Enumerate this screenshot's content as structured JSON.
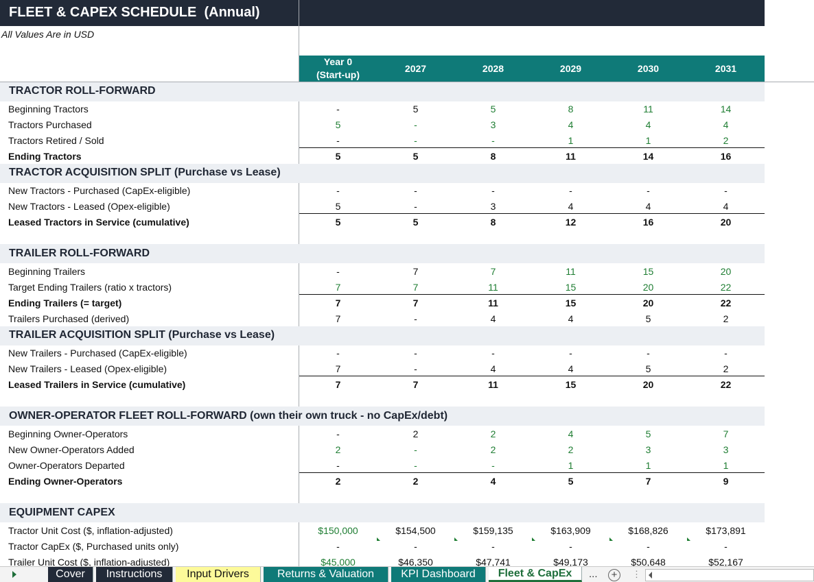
{
  "title": "FLEET & CAPEX SCHEDULE  (Annual)",
  "subtitle": "All Values Are in USD",
  "years": [
    "Year 0\n(Start-up)",
    "2027",
    "2028",
    "2029",
    "2030",
    "2031"
  ],
  "colors": {
    "header_dark": "#222a38",
    "header_teal": "#0f7a78",
    "input_green": "#1e7d32",
    "section_band": "#eceff3"
  },
  "sections": [
    {
      "title": "TRACTOR ROLL-FORWARD"
    },
    {
      "title": "TRACTOR ACQUISITION SPLIT (Purchase vs Lease)"
    },
    {
      "title": "TRAILER ROLL-FORWARD"
    },
    {
      "title": "TRAILER ACQUISITION SPLIT (Purchase vs Lease)"
    },
    {
      "title": "OWNER-OPERATOR FLEET ROLL-FORWARD  (own their own truck - no CapEx/debt)"
    },
    {
      "title": "EQUIPMENT CAPEX"
    }
  ],
  "rows": [
    {
      "label": "Beginning Tractors",
      "values": [
        "-",
        "5",
        "5",
        "8",
        "11",
        "14"
      ]
    },
    {
      "label": "Tractors Purchased",
      "values": [
        "5",
        "-",
        "3",
        "4",
        "4",
        "4"
      ]
    },
    {
      "label": "Tractors Retired / Sold",
      "values": [
        "-",
        "-",
        "-",
        "1",
        "1",
        "2"
      ]
    },
    {
      "label": "Ending Tractors",
      "values": [
        "5",
        "5",
        "8",
        "11",
        "14",
        "16"
      ]
    },
    {
      "label": "New Tractors - Purchased (CapEx-eligible)",
      "values": [
        "-",
        "-",
        "-",
        "-",
        "-",
        "-"
      ]
    },
    {
      "label": "New Tractors - Leased (Opex-eligible)",
      "values": [
        "5",
        "-",
        "3",
        "4",
        "4",
        "4"
      ]
    },
    {
      "label": "Leased Tractors in Service (cumulative)",
      "values": [
        "5",
        "5",
        "8",
        "12",
        "16",
        "20"
      ]
    },
    {
      "label": "Beginning Trailers",
      "values": [
        "-",
        "7",
        "7",
        "11",
        "15",
        "20"
      ]
    },
    {
      "label": "Target Ending Trailers (ratio x tractors)",
      "values": [
        "7",
        "7",
        "11",
        "15",
        "20",
        "22"
      ]
    },
    {
      "label": "Ending Trailers (= target)",
      "values": [
        "7",
        "7",
        "11",
        "15",
        "20",
        "22"
      ]
    },
    {
      "label": "Trailers Purchased (derived)",
      "values": [
        "7",
        "-",
        "4",
        "4",
        "5",
        "2"
      ]
    },
    {
      "label": "New Trailers - Purchased (CapEx-eligible)",
      "values": [
        "-",
        "-",
        "-",
        "-",
        "-",
        "-"
      ]
    },
    {
      "label": "New Trailers - Leased (Opex-eligible)",
      "values": [
        "7",
        "-",
        "4",
        "4",
        "5",
        "2"
      ]
    },
    {
      "label": "Leased Trailers in Service (cumulative)",
      "values": [
        "7",
        "7",
        "11",
        "15",
        "20",
        "22"
      ]
    },
    {
      "label": "Beginning Owner-Operators",
      "values": [
        "-",
        "2",
        "2",
        "4",
        "5",
        "7"
      ]
    },
    {
      "label": "New Owner-Operators Added",
      "values": [
        "2",
        "-",
        "2",
        "2",
        "3",
        "3"
      ]
    },
    {
      "label": "Owner-Operators Departed",
      "values": [
        "-",
        "-",
        "-",
        "1",
        "1",
        "1"
      ]
    },
    {
      "label": "Ending Owner-Operators",
      "values": [
        "2",
        "2",
        "4",
        "5",
        "7",
        "9"
      ]
    },
    {
      "label": "Tractor Unit Cost ($, inflation-adjusted)",
      "values": [
        "$150,000",
        "$154,500",
        "$159,135",
        "$163,909",
        "$168,826",
        "$173,891"
      ]
    },
    {
      "label": "Tractor CapEx ($, Purchased units only)",
      "values": [
        "-",
        "-",
        "-",
        "-",
        "-",
        "-"
      ]
    },
    {
      "label": "Trailer Unit Cost ($, inflation-adjusted)",
      "values": [
        "$45,000",
        "$46,350",
        "$47,741",
        "$49,173",
        "$50,648",
        "$52,167"
      ]
    }
  ],
  "tabs": [
    {
      "label": "Cover"
    },
    {
      "label": "Instructions"
    },
    {
      "label": "Input Drivers"
    },
    {
      "label": "Returns & Valuation"
    },
    {
      "label": "KPI Dashboard"
    },
    {
      "label": "Fleet & CapEx"
    }
  ],
  "tab_more": "...",
  "tab_add": "+",
  "tab_dots": "⋮"
}
